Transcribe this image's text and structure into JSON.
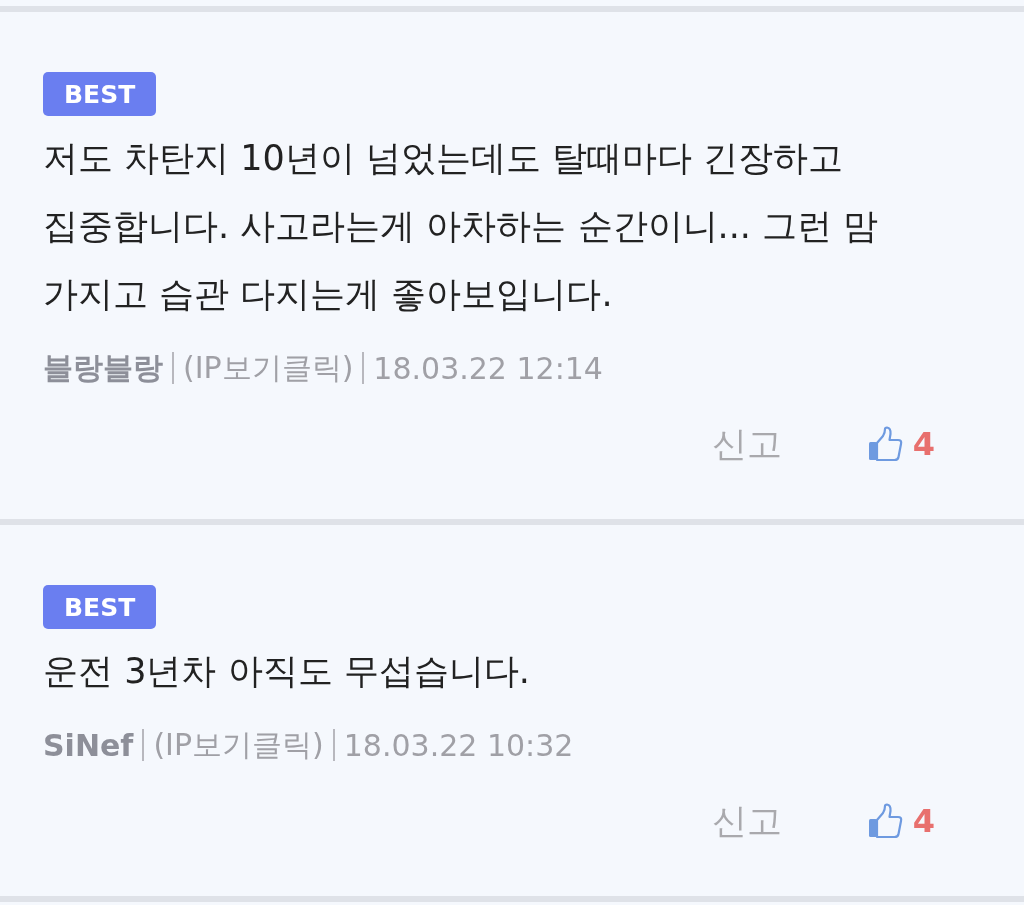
{
  "comments": [
    {
      "badge": "BEST",
      "text": "저도 차탄지 10년이 넘었는데도 탈때마다 긴장하고 집중합니다. 사고라는게 아차하는 순간이니... 그런 맘 가지고 습관 다지는게 좋아보입니다.",
      "author": "블랑블랑",
      "ip": "(IP보기클릭)",
      "date": "18.03.22 12:14",
      "report": "신고",
      "likes": "4"
    },
    {
      "badge": "BEST",
      "text": "운전 3년차 아직도 무섭습니다.",
      "author": "SiNef",
      "ip": "(IP보기클릭)",
      "date": "18.03.22 10:32",
      "report": "신고",
      "likes": "4"
    }
  ]
}
